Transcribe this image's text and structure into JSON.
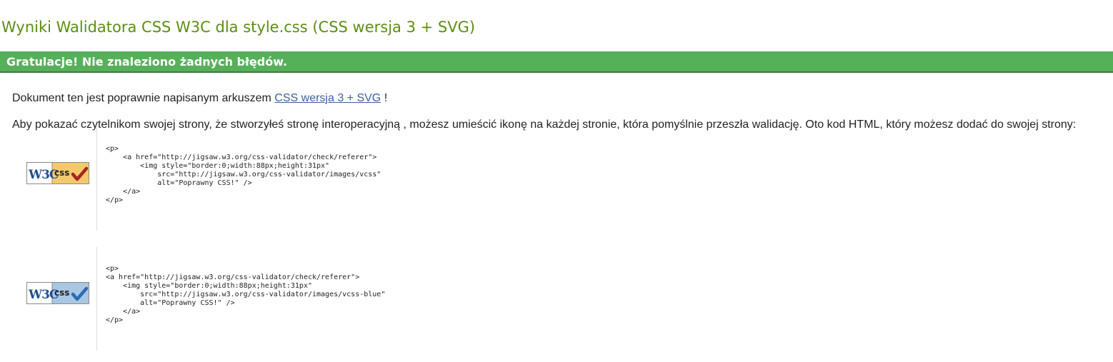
{
  "page_title": "Wyniki Walidatora CSS W3C dla style.css (CSS wersja 3 + SVG)",
  "congrats": "Gratulacje! Nie znaleziono żadnych błędów.",
  "paragraph1": {
    "before": "Dokument ten jest poprawnie napisanym arkuszem ",
    "link": "CSS wersja 3 + SVG",
    "after": " !"
  },
  "paragraph2": {
    "text": "Aby pokazać czytelnikom swojej strony, że stworzyłeś stronę interoperacyjną , możesz umieścić ikonę na każdej stronie, która pomyślnie przeszła walidację. Oto kod HTML, który możesz dodać do swojej strony:"
  },
  "badges": [
    {
      "w3c_text": "W3C",
      "css_text": "css",
      "variant": "gold",
      "icon": "w3c-css-gold-badge-icon",
      "code": "<p>\n    <a href=\"http://jigsaw.w3.org/css-validator/check/referer\">\n        <img style=\"border:0;width:88px;height:31px\"\n            src=\"http://jigsaw.w3.org/css-validator/images/vcss\"\n            alt=\"Poprawny CSS!\" />\n    </a>\n</p>"
    },
    {
      "w3c_text": "W3C",
      "css_text": "css",
      "variant": "blue",
      "icon": "w3c-css-blue-badge-icon",
      "code": "<p>\n<a href=\"http://jigsaw.w3.org/css-validator/check/referer\">\n    <img style=\"border:0;width:88px;height:31px\"\n        src=\"http://jigsaw.w3.org/css-validator/images/vcss-blue\"\n        alt=\"Poprawny CSS!\" />\n    </a>\n</p>"
    }
  ],
  "colors": {
    "title_green": "#5b8e14",
    "success_bar": "#56b05a",
    "link_blue": "#3b5fa2",
    "badge_gold": "#f5c96b",
    "badge_blue": "#a9c7e3",
    "check_red": "#a8241d",
    "check_blue": "#2e6bb5"
  }
}
